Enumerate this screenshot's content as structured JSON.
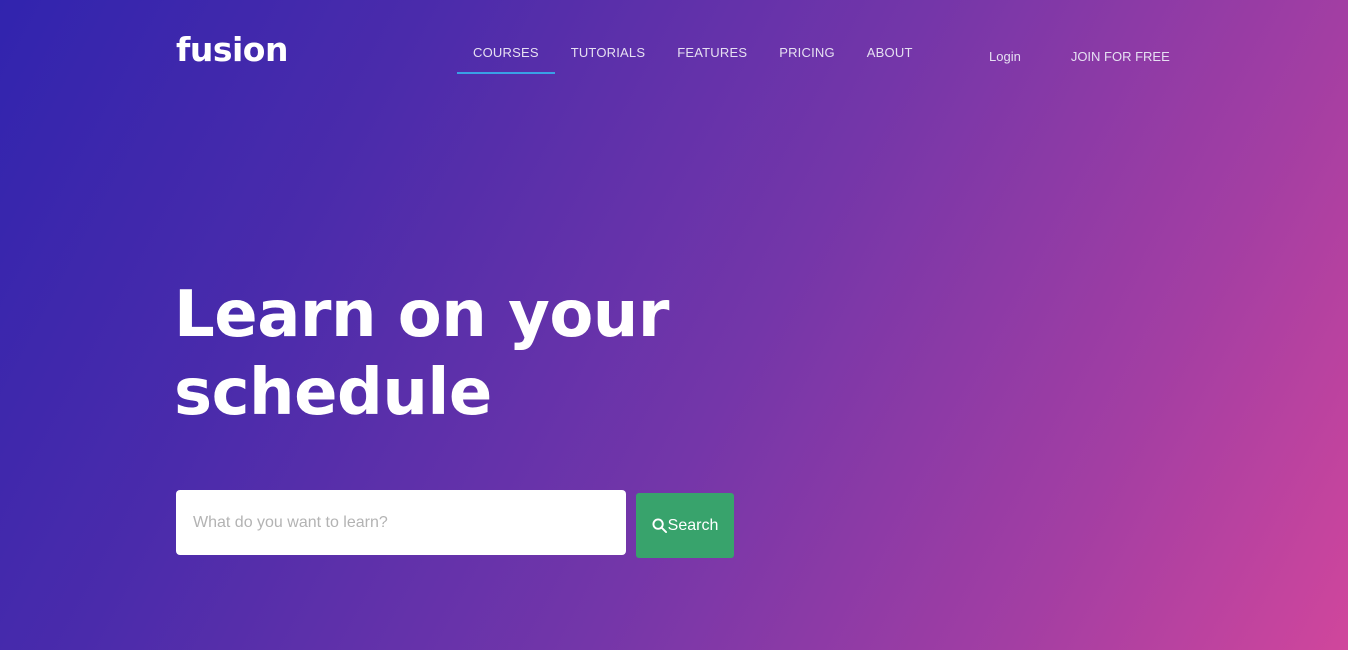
{
  "brand": {
    "logo_text": "fusion"
  },
  "nav": {
    "items": [
      {
        "label": "COURSES",
        "active": true
      },
      {
        "label": "TUTORIALS",
        "active": false
      },
      {
        "label": "FEATURES",
        "active": false
      },
      {
        "label": "PRICING",
        "active": false
      },
      {
        "label": "ABOUT",
        "active": false
      }
    ],
    "active_indicator_color": "#3aa0e6"
  },
  "auth": {
    "login_label": "Login",
    "join_label": "JOIN FOR FREE"
  },
  "hero": {
    "title_line1": "Learn on your",
    "title_line2": "schedule"
  },
  "search": {
    "placeholder": "What do you want to learn?",
    "value": "",
    "button_label": "Search",
    "button_icon": "search-icon",
    "button_color": "#38a36c"
  },
  "colors": {
    "gradient_start": "#3124ae",
    "gradient_end": "#d0469c"
  }
}
